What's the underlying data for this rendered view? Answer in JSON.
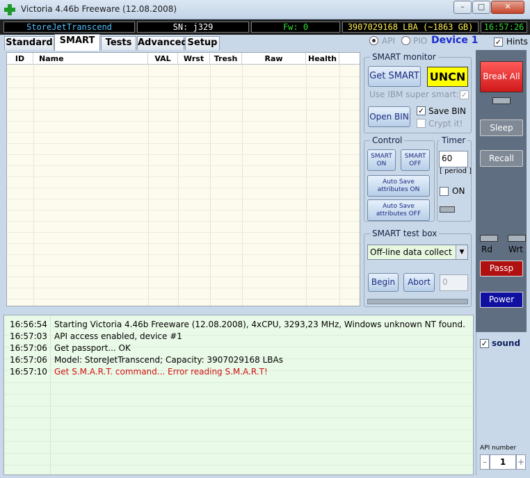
{
  "window": {
    "title": "Victoria 4.46b Freeware (12.08.2008)",
    "min_glyph": "–",
    "max_glyph": "□",
    "close_glyph": "✕"
  },
  "status": {
    "device": "StoreJetTranscend",
    "serial": "SN: j329",
    "firmware": "Fw: 0",
    "capacity": "3907029168 LBA (~1863 GB)",
    "clock": "16:57:26"
  },
  "tabs": [
    "Standard",
    "SMART",
    "Tests",
    "Advanced",
    "Setup"
  ],
  "mode": {
    "api_label": "API",
    "pio_label": "PIO",
    "device_label": "Device 1",
    "hints_label": "Hints"
  },
  "table": {
    "columns": [
      "ID",
      "Name",
      "VAL",
      "Wrst",
      "Tresh",
      "Raw",
      "Health"
    ]
  },
  "smart_monitor": {
    "title": "SMART monitor",
    "get_smart": "Get SMART",
    "status_badge": "UNCN",
    "ibm_label": "Use IBM super smart:",
    "open_bin": "Open BIN",
    "save_bin": "Save BIN",
    "crypt": "Crypt it!"
  },
  "control": {
    "title": "Control",
    "smart_on": [
      "SMART",
      "ON"
    ],
    "smart_off": [
      "SMART",
      "OFF"
    ],
    "autosave_on": [
      "Auto Save",
      "attributes ON"
    ],
    "autosave_off": [
      "Auto Save",
      "attributes OFF"
    ]
  },
  "timer": {
    "title": "Timer",
    "value": "60",
    "period": "[ period ]",
    "on_label": "ON"
  },
  "test_box": {
    "title": "SMART test box",
    "selected": "Off-line data collect",
    "begin": "Begin",
    "abort": "Abort",
    "counter": "0"
  },
  "side": {
    "break_all": "Break All",
    "sleep": "Sleep",
    "recall": "Recall",
    "rd": "Rd",
    "wrt": "Wrt",
    "passp": "Passp",
    "power": "Power",
    "sound": "sound",
    "api_number_label": "API number",
    "api_number": "1",
    "minus": "–",
    "plus": "+"
  },
  "log": [
    {
      "time": "16:56:54",
      "text": "Starting Victoria 4.46b Freeware (12.08.2008), 4xCPU, 3293,23 MHz, Windows unknown NT found.",
      "error": false
    },
    {
      "time": "16:57:03",
      "text": "API access enabled, device #1",
      "error": false
    },
    {
      "time": "16:57:06",
      "text": "Get passport... OK",
      "error": false
    },
    {
      "time": "16:57:06",
      "text": "Model: StoreJetTranscend; Capacity: 3907029168 LBAs",
      "error": false
    },
    {
      "time": "16:57:10",
      "text": "Get S.M.A.R.T. command... Error reading S.M.A.R.T!",
      "error": true
    }
  ],
  "colors": {
    "device_text": "#4fc0ff",
    "serial_text": "#ffffff",
    "firmware_text": "#33dd33",
    "capacity_text": "#ffee55",
    "clock_text": "#33dd33",
    "uncn_bg": "#ffff00",
    "break_all_bg": "#e02020",
    "passp_bg": "#b01010",
    "power_bg": "#1010a0",
    "error_text": "#d01010"
  }
}
